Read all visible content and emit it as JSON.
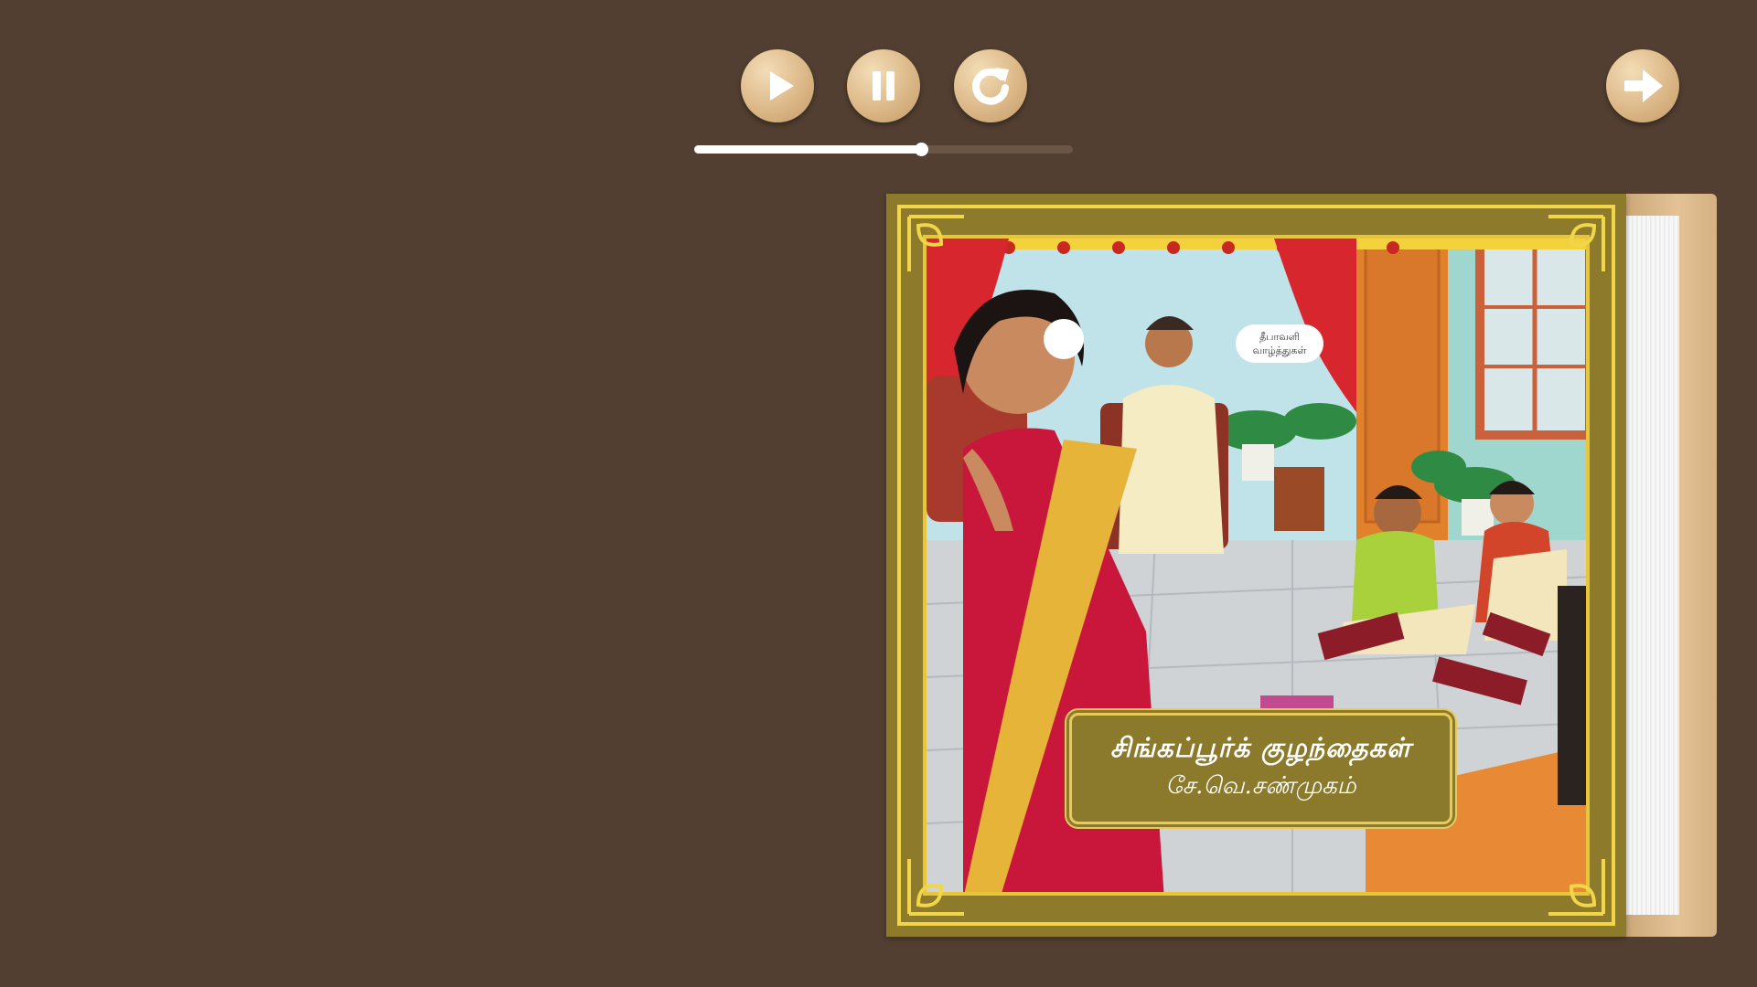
{
  "controls": {
    "play_icon": "play-icon",
    "pause_icon": "pause-icon",
    "replay_icon": "replay-icon",
    "next_icon": "arrow-right-icon"
  },
  "progress": {
    "fraction": 0.6
  },
  "book": {
    "title": "சிங்கப்பூர்க் குழந்தைகள்",
    "author": "சே.வெ.சண்முகம்",
    "speech_bubble": "தீபாவளி\nவாழ்த்துகள்"
  },
  "colors": {
    "background": "#523f31",
    "button": "#dcb888",
    "cover_gold": "#8d7a2a",
    "frame_yellow": "#f2d64a"
  }
}
